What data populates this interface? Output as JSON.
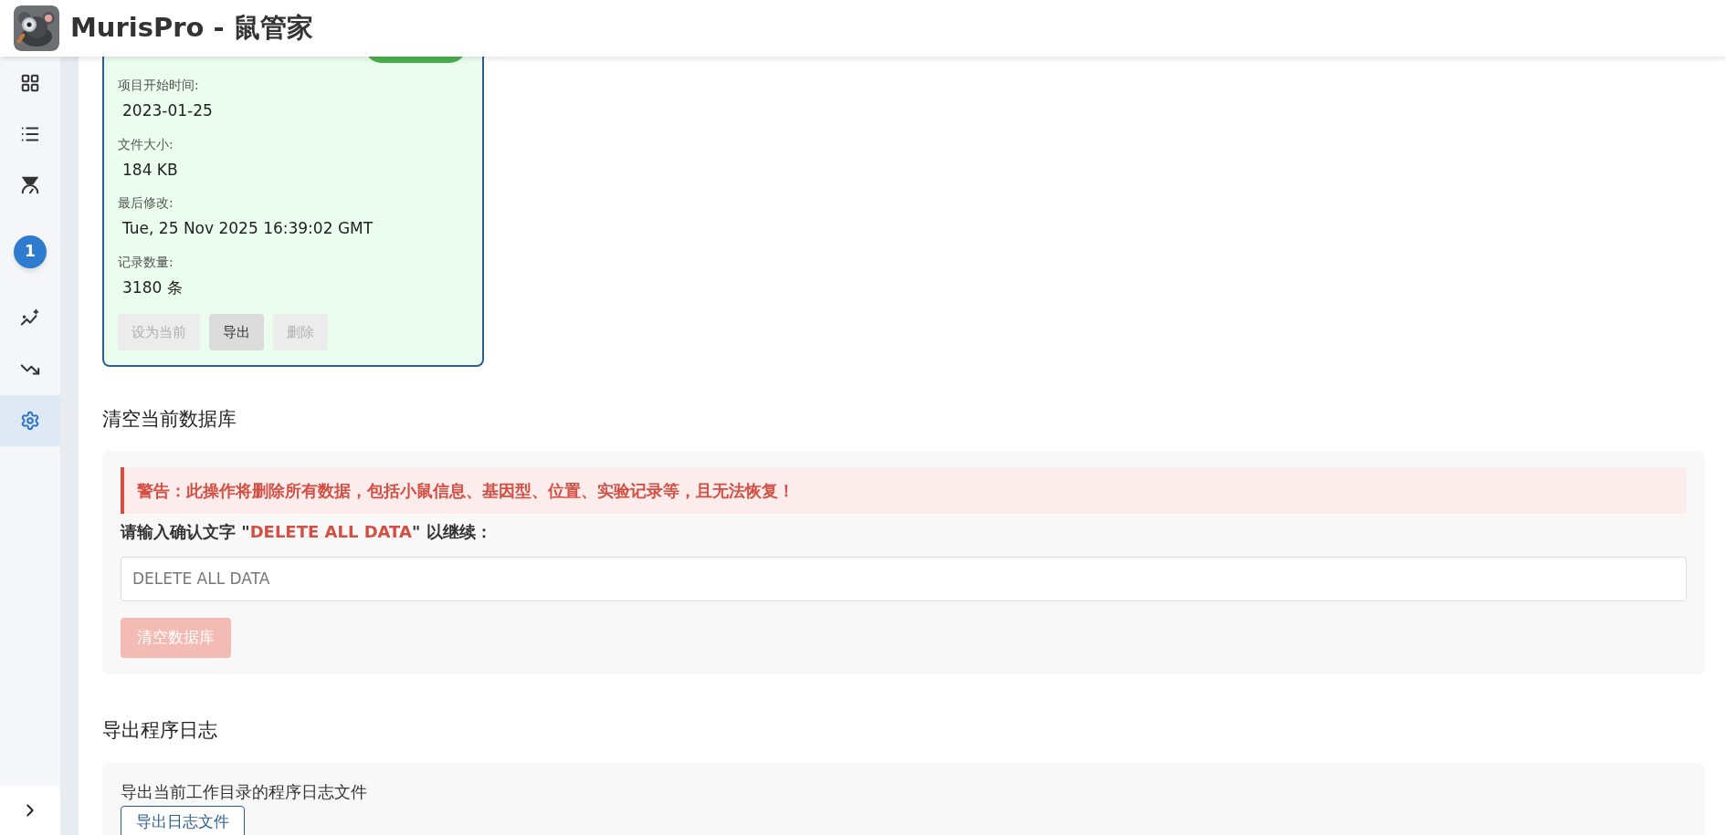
{
  "header": {
    "title": "MurisPro - 鼠管家"
  },
  "sidebar": {
    "items": [
      {
        "kind": "icon",
        "selected": false
      },
      {
        "kind": "icon",
        "selected": false
      },
      {
        "kind": "icon",
        "selected": false
      },
      {
        "kind": "badge",
        "text": "1",
        "selected": false
      },
      {
        "kind": "icon",
        "selected": false
      },
      {
        "kind": "icon",
        "selected": false
      },
      {
        "kind": "icon",
        "selected": true
      }
    ],
    "collapse_expanded": false
  },
  "database_card": {
    "current": true,
    "fields": [
      {
        "label": "项目开始时间:",
        "value": "2023-01-25"
      },
      {
        "label": "文件大小:",
        "value": "184 KB"
      },
      {
        "label": "最后修改:",
        "value": "Tue, 25 Nov 2025 16:39:02 GMT"
      },
      {
        "label": "记录数量:",
        "value": "3180 条"
      }
    ],
    "buttons": [
      {
        "label": "设为当前",
        "disabled": true
      },
      {
        "label": "导出",
        "disabled": false
      },
      {
        "label": "删除",
        "disabled": true
      }
    ]
  },
  "clear_section": {
    "heading": "清空当前数据库",
    "warning": "警告：此操作将删除所有数据，包括小鼠信息、基因型、位置、实验记录等，且无法恢复！",
    "prompt": "请输入确认文字 \"**DELETE ALL DATA**\" 以继续：",
    "input": {
      "placeholder": "DELETE ALL DATA"
    },
    "button": {
      "label": "清空数据库",
      "disabled": true
    }
  },
  "log_section": {
    "heading": "导出程序日志",
    "description": "导出当前工作目录的程序日志文件",
    "button": {
      "label": "导出日志文件"
    }
  }
}
